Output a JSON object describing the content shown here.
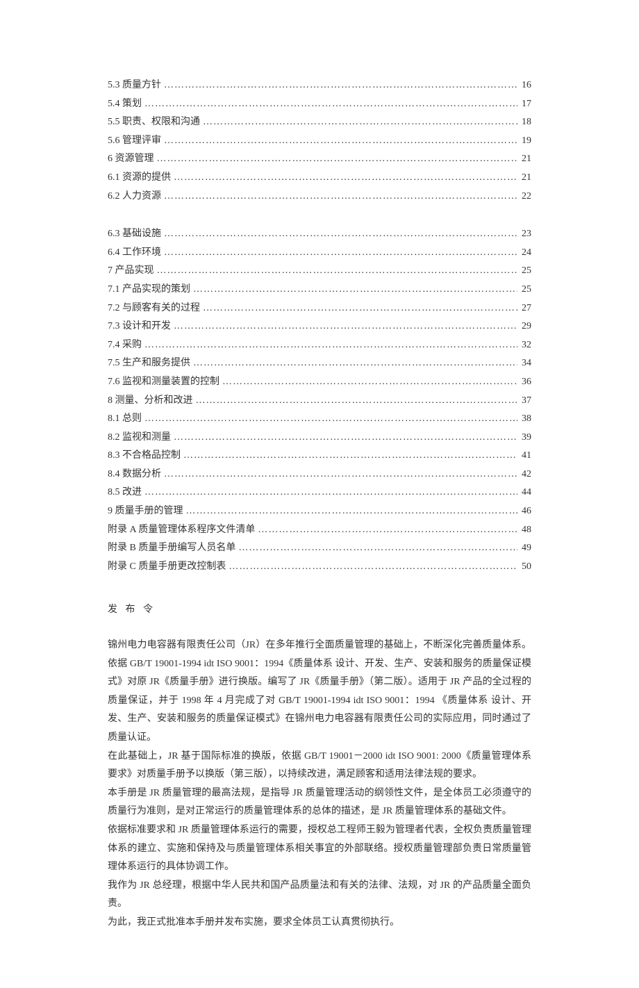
{
  "toc_group_a": [
    {
      "label": "5.3 质量方针",
      "page": "16"
    },
    {
      "label": "5.4 策划",
      "page": "17"
    },
    {
      "label": "5.5 职责、权限和沟通",
      "page": "18"
    },
    {
      "label": "5.6 管理评审",
      "page": "19"
    },
    {
      "label": "6 资源管理",
      "page": "21"
    },
    {
      "label": "6.1 资源的提供",
      "page": "21"
    },
    {
      "label": "6.2 人力资源",
      "page": "22"
    }
  ],
  "toc_group_b": [
    {
      "label": "6.3 基础设施",
      "page": "23"
    },
    {
      "label": "6.4 工作环境",
      "page": "24"
    },
    {
      "label": "7 产品实现",
      "page": "25"
    },
    {
      "label": "7.1 产品实现的策划",
      "page": "25"
    },
    {
      "label": "7.2 与顾客有关的过程",
      "page": "27"
    },
    {
      "label": "7.3 设计和开发",
      "page": "29"
    },
    {
      "label": "7.4 采购",
      "page": "32"
    },
    {
      "label": "7.5 生产和服务提供",
      "page": "34"
    },
    {
      "label": "7.6 监视和测量装置的控制",
      "page": "36"
    },
    {
      "label": "8 测量、分析和改进",
      "page": "37"
    },
    {
      "label": "8.1 总则",
      "page": "38"
    },
    {
      "label": "8.2 监视和测量",
      "page": "39"
    },
    {
      "label": "8.3 不合格品控制",
      "page": "41"
    },
    {
      "label": "8.4 数据分析",
      "page": "42"
    },
    {
      "label": "8.5 改进",
      "page": "44"
    },
    {
      "label": "9 质量手册的管理",
      "page": "46"
    },
    {
      "label": "附录 A 质量管理体系程序文件清单",
      "page": "48"
    },
    {
      "label": "附录 B 质量手册编写人员名单",
      "page": "49"
    },
    {
      "label": "附录 C 质量手册更改控制表",
      "page": "50"
    }
  ],
  "order": {
    "title": "发 布 令",
    "paragraphs": [
      "锦州电力电容器有限责任公司（JR）在多年推行全面质量管理的基础上，不断深化完善质量体系。依据 GB/T 19001-1994 idt ISO 9001：1994《质量体系 设计、开发、生产、安装和服务的质量保证模式》对原 JR《质量手册》进行换版。编写了 JR《质量手册》（第二版）。适用于 JR 产品的全过程的质量保证，并于 1998 年 4 月完成了对 GB/T 19001-1994 idt ISO 9001：1994 《质量体系 设计、开发、生产、安装和服务的质量保证模式》在锦州电力电容器有限责任公司的实际应用，同时通过了质量认证。",
      "在此基础上，JR 基于国际标准的换版，依据 GB/T 19001－2000 idt ISO 9001: 2000《质量管理体系 要求》对质量手册予以换版（第三版），以持续改进，满足顾客和适用法律法规的要求。",
      "本手册是 JR 质量管理的最高法规，是指导 JR 质量管理活动的纲领性文件，是全体员工必须遵守的质量行为准则，是对正常运行的质量管理体系的总体的描述，是 JR 质量管理体系的基础文件。",
      "依据标准要求和 JR 质量管理体系运行的需要，授权总工程师王毅为管理者代表，全权负责质量管理体系的建立、实施和保持及与质量管理体系相关事宜的外部联络。授权质量管理部负责日常质量管理体系运行的具体协调工作。",
      "我作为 JR 总经理，根据中华人民共和国产品质量法和有关的法律、法规，对 JR 的产品质量全面负责。",
      "为此，我正式批准本手册并发布实施，要求全体员工认真贯彻执行。"
    ]
  }
}
